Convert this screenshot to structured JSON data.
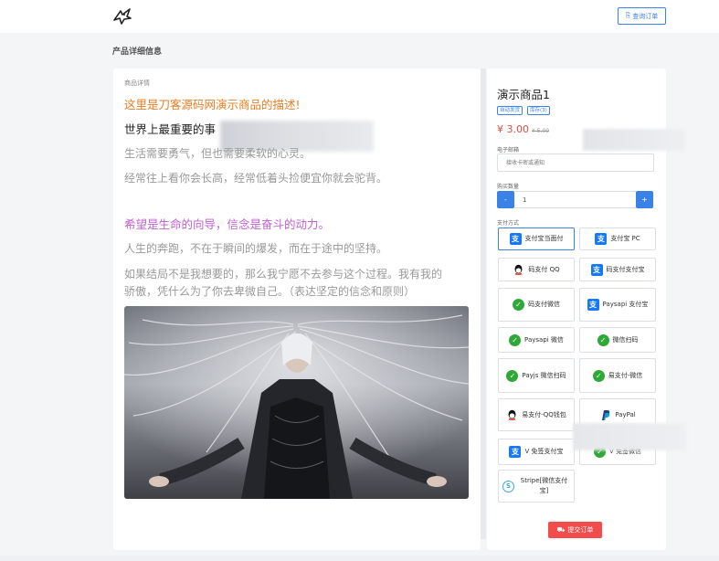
{
  "header": {
    "query_order_label": "查询订单"
  },
  "page": {
    "title": "产品详细信息"
  },
  "detail": {
    "label": "商品详情",
    "lines": [
      "这里是刀客源码网演示商品的描述!",
      "世界上最重要的事",
      "生活需要勇气，但也需要柔软的心灵。",
      "经常往上看你会长高，经常低着头捡便宜你就会驼背。",
      "希望是生命的向导，信念是奋斗的动力。",
      "人生的奔跑，不在于瞬间的爆发，而在于途中的坚持。",
      "如果结局不是我想要的，那么我宁愿不去参与这个过程。我有我的",
      "骄傲，凭什么为了你去卑微自己。（表达坚定的信念和原则）"
    ]
  },
  "product": {
    "name": "演示商品1",
    "badges": [
      "自动发货",
      "库存(3)"
    ],
    "price": "¥ 3.00",
    "old_price": "¥ 5.00",
    "email_label": "电子邮箱",
    "email_placeholder": "接收卡密或通知",
    "qty_label": "购买数量",
    "qty_value": "1",
    "qty_minus": "-",
    "qty_plus": "+",
    "pay_label": "支付方式",
    "submit_label": "提交订单"
  },
  "payments": [
    {
      "label": "支付宝当面付",
      "icon": "alipay-icon"
    },
    {
      "label": "支付宝 PC",
      "icon": "alipay-icon"
    },
    {
      "label": "码支付 QQ",
      "icon": "qq-icon"
    },
    {
      "label": "码支付支付宝",
      "icon": "alipay-icon"
    },
    {
      "label": "码支付微信",
      "icon": "wechat-icon"
    },
    {
      "label": "Paysapi 支付宝",
      "icon": "alipay-icon"
    },
    {
      "label": "Paysapi 微信",
      "icon": "wechat-icon"
    },
    {
      "label": "微信扫码",
      "icon": "wechat-icon"
    },
    {
      "label": "Payjs 微信扫码",
      "icon": "wechat-icon"
    },
    {
      "label": "易支付-微信",
      "icon": "wechat-icon"
    },
    {
      "label": "易支付-QQ钱包",
      "icon": "qq-icon"
    },
    {
      "label": "PayPal",
      "icon": "paypal-icon"
    },
    {
      "label": "V 免签支付宝",
      "icon": "alipay-icon"
    },
    {
      "label": "V 免签微信",
      "icon": "wechat-icon"
    },
    {
      "label": "Stripe[微信支付宝]",
      "icon": "stripe-icon"
    }
  ],
  "colors": {
    "accent": "#3b82e6",
    "price": "#e74c3c",
    "submit": "#f24c4c",
    "desc_orange": "#e67e22",
    "desc_purple": "#c05fd1"
  }
}
